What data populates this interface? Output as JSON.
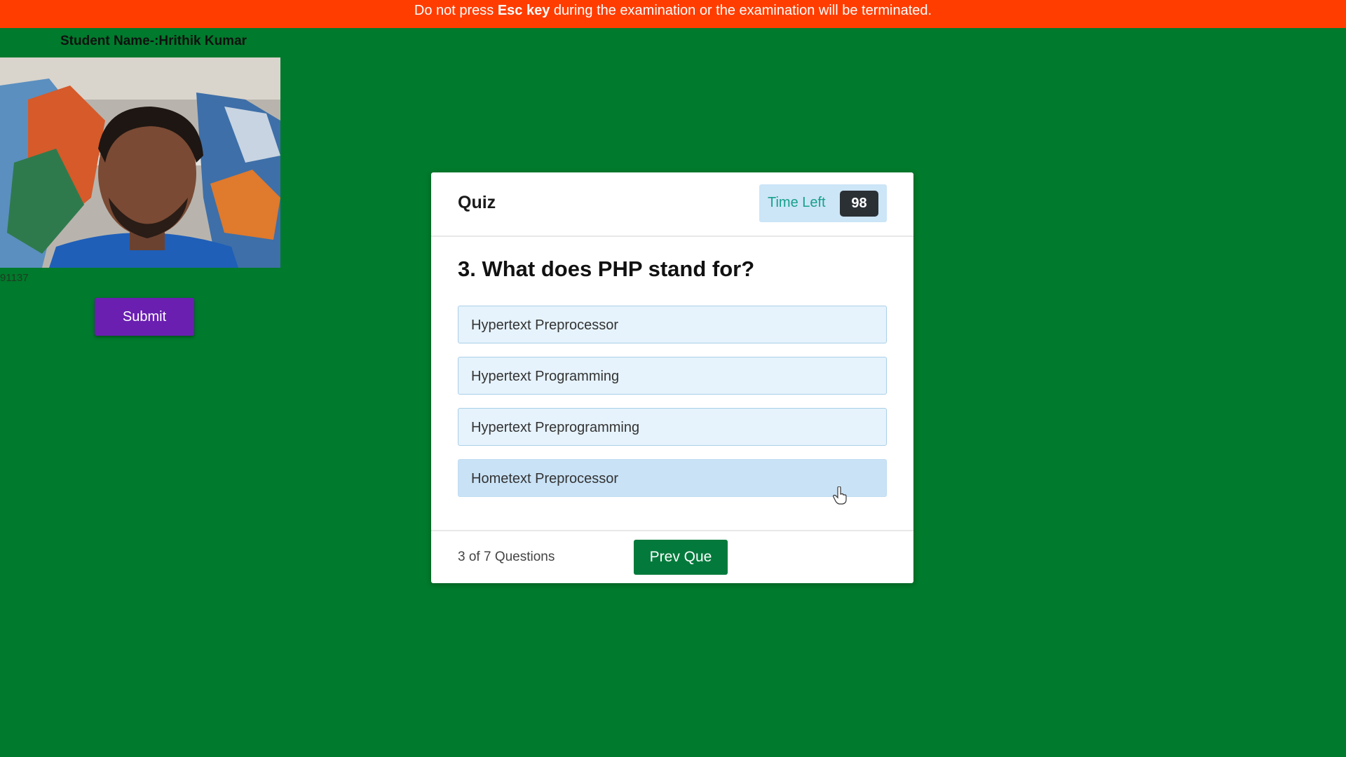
{
  "warning": {
    "prefix": "Do not press ",
    "key": "Esc key",
    "suffix": " during the examination or the examination will be terminated."
  },
  "student": {
    "name_label": "Student Name-:Hrithik Kumar",
    "webcam_code": "91137"
  },
  "sidebar": {
    "submit_label": "Submit"
  },
  "quiz": {
    "title": "Quiz",
    "timer_label": "Time Left",
    "timer_value": "98",
    "question": "3. What does PHP stand for?",
    "options": [
      {
        "label": "Hypertext Preprocessor"
      },
      {
        "label": "Hypertext Programming"
      },
      {
        "label": "Hypertext Preprogramming"
      },
      {
        "label": "Hometext Preprocessor"
      }
    ],
    "progress_text": "3 of 7 Questions",
    "prev_label": "Prev Que"
  },
  "colors": {
    "background": "#007a2c",
    "warning_bar": "#ff3d00",
    "submit_button": "#6a1fb1",
    "prev_button": "#037a3c",
    "option_bg": "#e6f3fc",
    "option_hover_bg": "#c9e2f6",
    "timer_badge": "#2b3035"
  },
  "icons": {
    "cursor": "hand-pointer-icon"
  }
}
